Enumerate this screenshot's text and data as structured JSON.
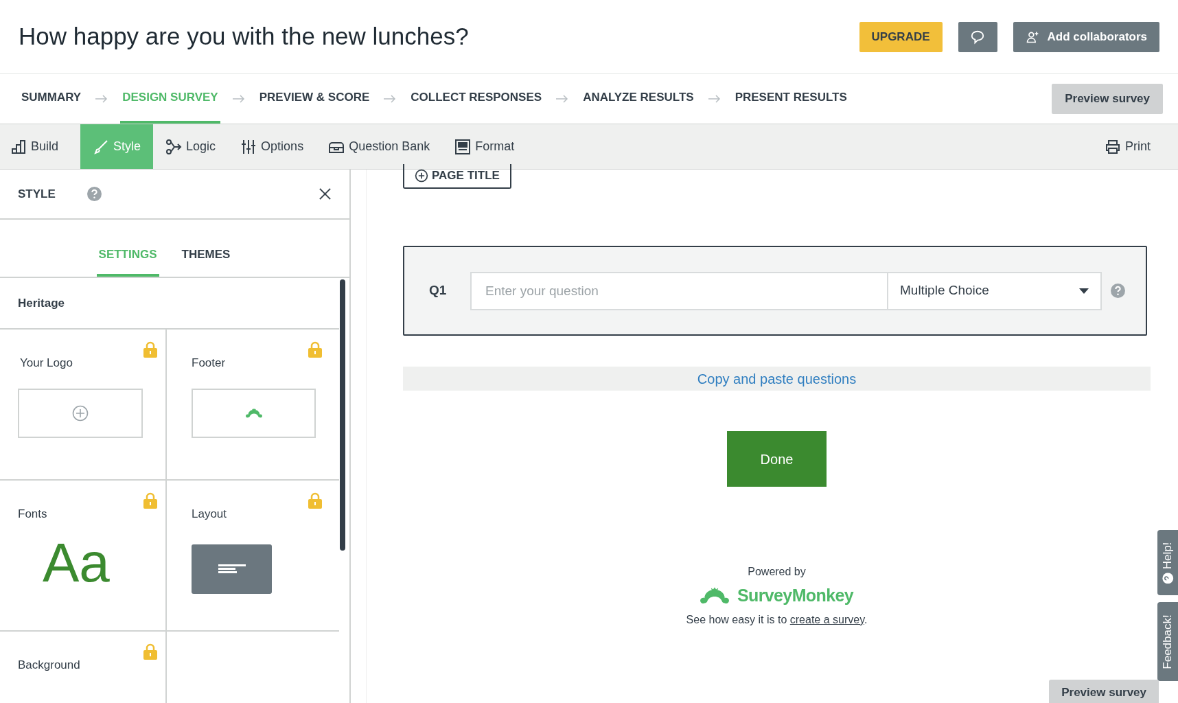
{
  "header": {
    "title": "How happy are you with the new lunches?",
    "upgrade": "UPGRADE",
    "collaborators": "Add collaborators"
  },
  "steps": [
    {
      "label": "SUMMARY",
      "selected": false
    },
    {
      "label": "DESIGN SURVEY",
      "selected": true
    },
    {
      "label": "PREVIEW & SCORE",
      "selected": false
    },
    {
      "label": "COLLECT RESPONSES",
      "selected": false
    },
    {
      "label": "ANALYZE RESULTS",
      "selected": false
    },
    {
      "label": "PRESENT RESULTS",
      "selected": false
    }
  ],
  "preview_button": "Preview survey",
  "toolbar": [
    {
      "label": "Build",
      "kind": "build",
      "selected": false
    },
    {
      "label": "Style",
      "kind": "style",
      "selected": true
    },
    {
      "label": "Logic",
      "kind": "logic",
      "selected": false
    },
    {
      "label": "Options",
      "kind": "options",
      "selected": false
    },
    {
      "label": "Question Bank",
      "kind": "bank",
      "selected": false
    },
    {
      "label": "Format",
      "kind": "format",
      "selected": false
    }
  ],
  "print": "Print",
  "style_panel": {
    "title": "STYLE",
    "tabs": [
      {
        "label": "SETTINGS",
        "selected": true
      },
      {
        "label": "THEMES",
        "selected": false
      }
    ],
    "theme_name": "Heritage",
    "cells": [
      {
        "label": "Your Logo",
        "kind": "logo",
        "locked": true
      },
      {
        "label": "Footer",
        "kind": "footer",
        "locked": true
      },
      {
        "label": "Fonts",
        "kind": "fonts",
        "locked": true,
        "sample": "Aa"
      },
      {
        "label": "Layout",
        "kind": "layout",
        "locked": true
      },
      {
        "label": "Background",
        "kind": "background",
        "locked": true
      }
    ]
  },
  "survey": {
    "page_title_button": "PAGE TITLE",
    "question": {
      "number": "Q1",
      "placeholder": "Enter your question",
      "type": "Multiple Choice"
    },
    "copy_paste": "Copy and paste questions",
    "done": "Done",
    "footer": {
      "powered_by": "Powered by",
      "brand": "SurveyMonkey",
      "text_before": "See how easy it is to",
      "link": "create a survey",
      "text_after": "."
    }
  },
  "side_tabs": [
    "Help!",
    "Feedback!"
  ],
  "bottom_button": "Preview survey"
}
